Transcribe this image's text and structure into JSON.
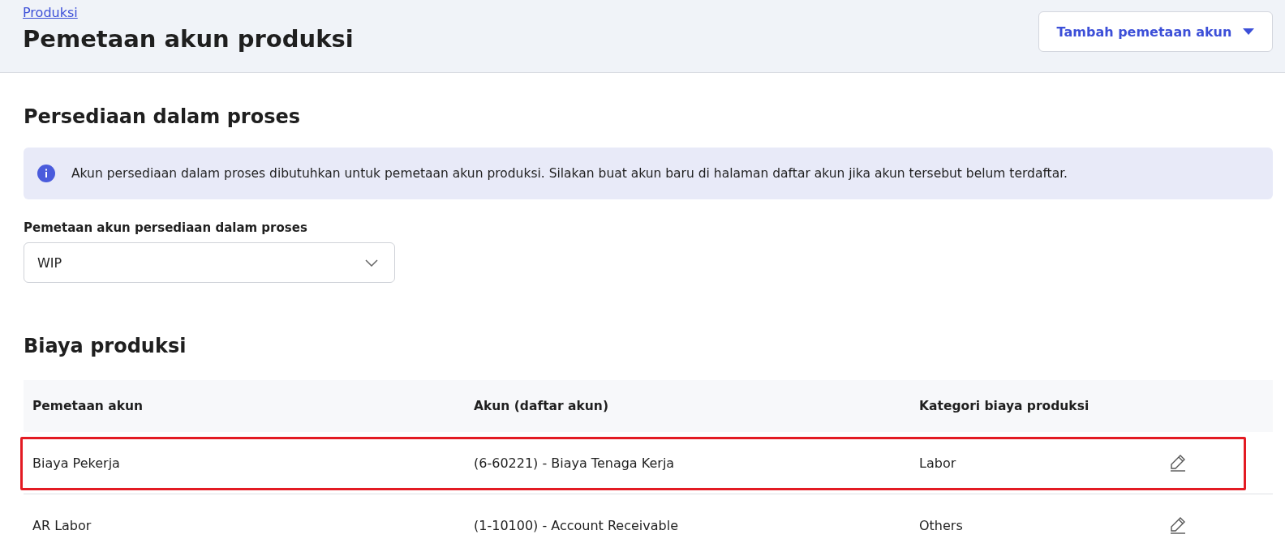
{
  "header": {
    "breadcrumb": "Produksi",
    "title": "Pemetaan akun produksi",
    "action_button": "Tambah pemetaan akun"
  },
  "wip_section": {
    "title": "Persediaan dalam proses",
    "info": "Akun persediaan dalam proses dibutuhkan untuk pemetaan akun produksi. Silakan buat akun baru di halaman daftar akun jika akun tersebut belum terdaftar.",
    "field_label": "Pemetaan akun persediaan dalam proses",
    "field_value": "WIP"
  },
  "cost_section": {
    "title": "Biaya produksi",
    "table": {
      "columns": [
        "Pemetaan akun",
        "Akun (daftar akun)",
        "Kategori biaya produksi"
      ],
      "rows": [
        {
          "cells": [
            "Biaya Pekerja",
            "(6-60221) - Biaya Tenaga Kerja",
            "Labor"
          ],
          "highlighted": true
        },
        {
          "cells": [
            "AR Labor",
            "(1-10100) - Account Receivable",
            "Others"
          ],
          "highlighted": false
        }
      ]
    }
  }
}
